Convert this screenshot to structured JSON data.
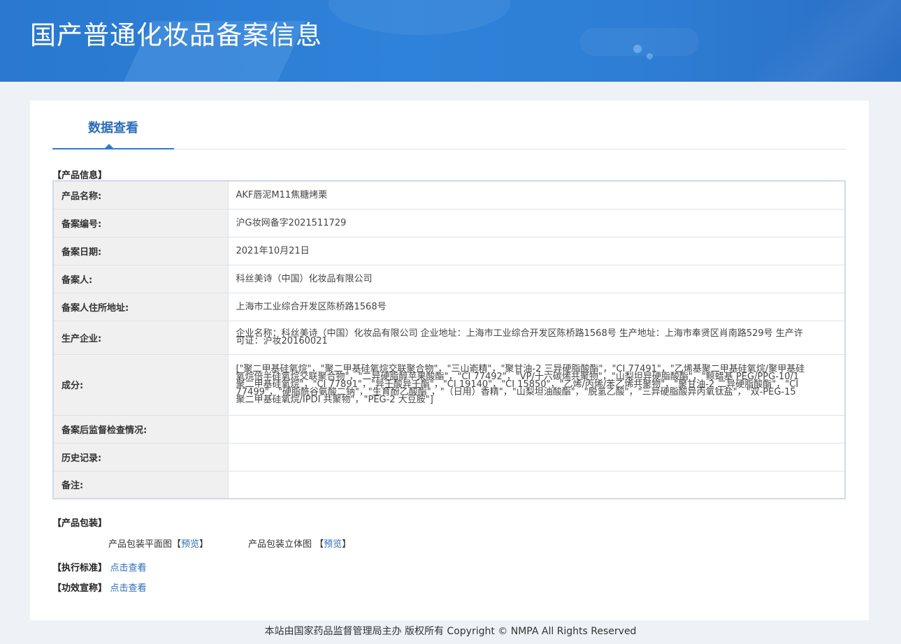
{
  "banner": {
    "title": "国产普通化妆品备案信息"
  },
  "tabs": {
    "active": "数据查看"
  },
  "product_info": {
    "section_title": "【产品信息】",
    "rows": [
      {
        "label": "产品名称:",
        "value": "AKF唇泥M11焦糖烤栗"
      },
      {
        "label": "备案编号:",
        "value": "沪G妆网备字2021511729"
      },
      {
        "label": "备案日期:",
        "value": "2021年10月21日"
      },
      {
        "label": "备案人:",
        "value": "科丝美诗（中国）化妆品有限公司"
      },
      {
        "label": "备案人住所地址:",
        "value": "上海市工业综合开发区陈桥路1568号"
      },
      {
        "label": "生产企业:",
        "value": "企业名称：科丝美诗（中国）化妆品有限公司 企业地址：上海市工业综合开发区陈桥路1568号 生产地址：上海市奉贤区肖南路529号 生产许可证：沪妆20160021"
      },
      {
        "label": "成分:",
        "value": "[\"聚二甲基硅氧烷\"，\"聚二甲基硅氧烷交联聚合物\"，\"三山嵛精\"，\"聚甘油-2 三异硬脂酸酯\"，\"CI 77491\"，\"乙烯基聚二甲基硅氧烷/聚甲基硅氧烷倍半硅氧烷交联聚合物\"，\"二异硬脂醇苹果酸酯\"，\"CI 77492\"，\"VP/十六碳烯共聚物\"，\"山梨坦异硬脂酸酯\"，\"鲸蜡基 PEG/PPG-10/1 聚二甲基硅氧烷\"，\"CI 77891\"，\"异壬酸异壬酯\"，\"CI 19140\"，\"CI 15850\"，\"乙烯/丙烯/苯乙烯共聚物\"，\"聚甘油-2 二异硬脂酸酯\"，\"CI 77499\"，\"硬脂酰谷氨酸二钠\"，\"生育酚乙酸酯\"，\"（日用）香精\"，\"山梨坦油酸酯\"，\"脱氢乙酸\"，\"三异硬脂酸异丙氧钛盐\"，\"双-PEG-15 聚二甲基硅氧烷/IPDI 共聚物\"，\"PEG-2 大豆胺\"]"
      },
      {
        "label": "备案后监督检查情况:",
        "value": ""
      },
      {
        "label": "历史记录:",
        "value": ""
      },
      {
        "label": "备注:",
        "value": ""
      }
    ]
  },
  "packaging": {
    "section_title": "【产品包装】",
    "flat_label": "产品包装平面图",
    "flat_link": "预览",
    "solid_label": "产品包装立体图",
    "solid_link": "预览",
    "bracket_open": "【",
    "bracket_close": "】"
  },
  "standard": {
    "label": "【执行标准】",
    "link": "点击查看"
  },
  "efficacy": {
    "label": "【功效宣称】",
    "link": "点击查看"
  },
  "footer": {
    "text": "本站由国家药品监督管理局主办 版权所有 Copyright © NMPA All Rights Reserved"
  }
}
